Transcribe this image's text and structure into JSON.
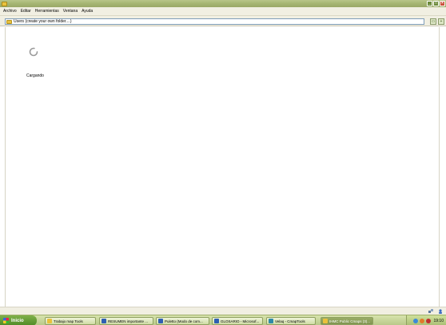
{
  "menu": [
    "Archivo",
    "Editar",
    "Herramientas",
    "Ventana",
    "Ayuda"
  ],
  "address": {
    "value": "Users (create your own folder....)"
  },
  "content": {
    "loading_text": "Cargando"
  },
  "taskbar": {
    "start_label": "Inicio",
    "tasks": [
      {
        "label": "Trabajo map Tools",
        "icon": "folder-icon"
      },
      {
        "label": "RESUMEN importante ...",
        "icon": "word-document-icon"
      },
      {
        "label": "Puletto (Modo de com...",
        "icon": "word-document-icon"
      },
      {
        "label": "GLOSARIO - Microsof...",
        "icon": "word-document-icon"
      },
      {
        "label": "Velaq - CmapTools",
        "icon": "cmap-icon"
      },
      {
        "label": "IHMC Public Cmaps (3)...",
        "icon": "folder-icon"
      }
    ],
    "clock": "19:10"
  },
  "colors": {
    "accent": "#9aa866",
    "start": "#4e8a26",
    "close": "#c9503a"
  }
}
